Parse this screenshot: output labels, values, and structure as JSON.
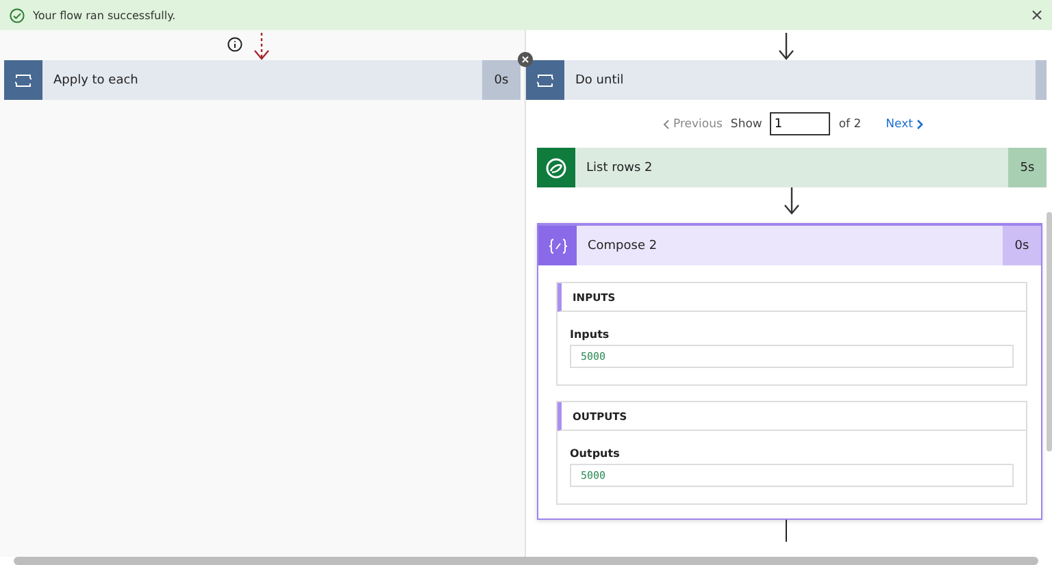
{
  "banner": {
    "message": "Your flow ran successfully."
  },
  "left_card": {
    "kind": "loop",
    "title": "Apply to each",
    "duration": "0s"
  },
  "right": {
    "do_until": {
      "kind": "loop",
      "title": "Do until"
    },
    "pager": {
      "previous": "Previous",
      "previous_disabled": true,
      "show": "Show",
      "value": "1",
      "of": "of 2",
      "next": "Next"
    },
    "actions": [
      {
        "kind": "dataverse",
        "title": "List rows 2",
        "duration": "5s",
        "expanded": false
      },
      {
        "kind": "compose",
        "title": "Compose 2",
        "duration": "0s",
        "expanded": true,
        "sections": [
          {
            "heading": "INPUTS",
            "label": "Inputs",
            "value": "5000"
          },
          {
            "heading": "OUTPUTS",
            "label": "Outputs",
            "value": "5000"
          }
        ]
      }
    ]
  }
}
